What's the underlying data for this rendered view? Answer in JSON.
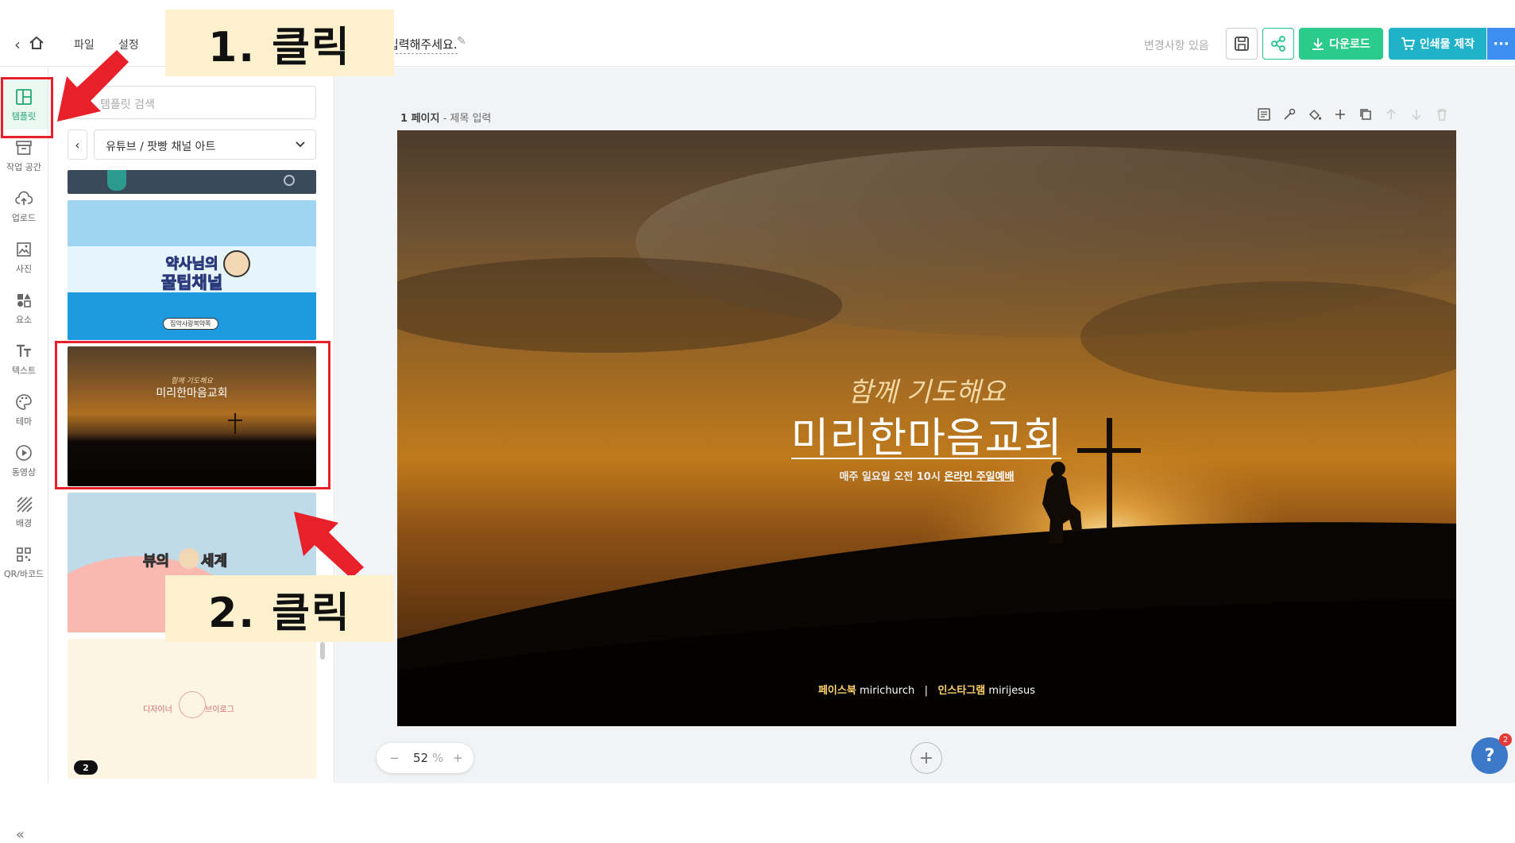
{
  "topbar": {
    "menu": [
      "파일",
      "설정"
    ],
    "title_partial": "입력해주세요.",
    "status": "변경사항 있음",
    "download_label": "다운로드",
    "print_label": "인쇄물 제작",
    "more_label": "···"
  },
  "annotations": {
    "step1": "1. 클릭",
    "step2": "2. 클릭"
  },
  "sidebar": {
    "items": [
      {
        "label": "템플릿",
        "icon": "layout-icon"
      },
      {
        "label": "작업 공간",
        "icon": "archive-icon"
      },
      {
        "label": "업로드",
        "icon": "cloud-upload-icon"
      },
      {
        "label": "사진",
        "icon": "image-icon"
      },
      {
        "label": "요소",
        "icon": "shapes-icon"
      },
      {
        "label": "텍스트",
        "icon": "text-icon"
      },
      {
        "label": "테마",
        "icon": "palette-icon"
      },
      {
        "label": "동영상",
        "icon": "play-icon"
      },
      {
        "label": "배경",
        "icon": "background-icon"
      },
      {
        "label": "QR/바코드",
        "icon": "qr-icon"
      }
    ],
    "collapse_label": "«"
  },
  "panel": {
    "search_placeholder": "템플릿 검색",
    "category": "유튜브 / 팟빵 채널 아트",
    "thumbnails": {
      "pharmacist_title": "약사님의",
      "pharmacist_title2": "꿀팁채널",
      "pharmacist_badge": "집약사랑복약쪽",
      "church_script": "함께 기도해요",
      "church_title": "미리한마음교회",
      "pop_title_left": "뷰의",
      "pop_title_right": "세계",
      "designer_title_left": "디자이너",
      "designer_title_right": "브이로그"
    },
    "page_badge": "2"
  },
  "editor": {
    "page_number": "1 페이지",
    "page_title_placeholder": "- 제목 입력",
    "zoom_value": "52",
    "zoom_unit": "%"
  },
  "canvas": {
    "script_text": "함께 기도해요",
    "title": "미리한마음교회",
    "subtitle_prefix": "매주 일요일 오전 10시 ",
    "subtitle_emphasis": "온라인 주일예배",
    "footer_facebook_label": "페이스북",
    "footer_facebook_handle": "mirichurch",
    "footer_separator": "|",
    "footer_instagram_label": "인스타그램",
    "footer_instagram_handle": "mirijesus"
  },
  "help": {
    "label": "?",
    "badge": "2"
  }
}
